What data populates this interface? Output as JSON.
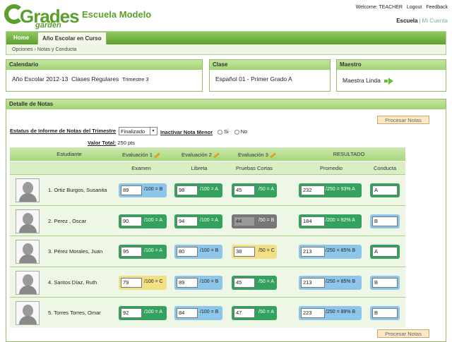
{
  "header": {
    "logo_main": "Grades",
    "logo_sub": "garden",
    "school": "Escuela Modelo",
    "welcome": "Welcome: TEACHER",
    "logout": "Logout",
    "feedback": "Feedback",
    "lang_active": "Escuela",
    "lang_other": "Mi Cuenta"
  },
  "nav": {
    "tabs": [
      "Home",
      "Año Escolar en Curso"
    ],
    "breadcrumb": [
      "Opciones",
      "Notas y Conducta"
    ]
  },
  "calendario": {
    "title": "Calendario",
    "year": "Año Escolar 2012-13",
    "type": "Clases Regulares",
    "term": "Trimestre 3"
  },
  "clase": {
    "title": "Clase",
    "name": "Español 01 -  Primer Grado  A"
  },
  "maestro": {
    "title": "Maestro",
    "name": "Maestra Linda"
  },
  "detalle": {
    "title": "Detalle de Notas",
    "process_label": "Procesar Notas",
    "status_label": "Estatus de Informe de Notas del Trimestre",
    "status_value": "Finalizado",
    "inactivar_label": "Inactivar Nota Menor",
    "radio_si": "Si",
    "radio_no": "No",
    "valor_label": "Valor Total:",
    "valor_value": "250 pts"
  },
  "table": {
    "h_student": "Estudiante",
    "h_eval1": "Evaluación 1",
    "h_eval2": "Evaluación 2",
    "h_eval3": "Evaluación 3",
    "h_result": "RESULTADO",
    "h_examen": "Examen",
    "h_libreta": "Libreta",
    "h_pruebas": "Pruebas Cortas",
    "h_promedio": "Promedio",
    "h_conducta": "Conducta",
    "rows": [
      {
        "name": "1. Ortiz Burgos, Susanita",
        "examen": "89",
        "examen_l": "/100 = B",
        "examen_c": "c-b",
        "libreta": "98",
        "libreta_l": "/100 = A",
        "libreta_c": "c-g",
        "pruebas": "45",
        "pruebas_l": "/50 = A",
        "pruebas_c": "c-g",
        "prom": "232",
        "prom_l": "/250 = 93% A",
        "prom_c": "c-g",
        "conducta": "A",
        "conducta_c": "c-g"
      },
      {
        "name": "2. Perez , Oscar",
        "examen": "90",
        "examen_l": "/100 = A",
        "examen_c": "c-g",
        "libreta": "94",
        "libreta_l": "/100 = A",
        "libreta_c": "c-g",
        "pruebas": "44",
        "pruebas_l": "/50 = B",
        "pruebas_c": "c-gr",
        "prom": "184",
        "prom_l": "/200 = 92% A",
        "prom_c": "c-g",
        "conducta": "B",
        "conducta_c": "c-b"
      },
      {
        "name": "3. Pérez Morales, Juan",
        "examen": "95",
        "examen_l": "/100 = A",
        "examen_c": "c-g",
        "libreta": "80",
        "libreta_l": "/100 = B",
        "libreta_c": "c-b",
        "pruebas": "38",
        "pruebas_l": "/50 = C",
        "pruebas_c": "c-y",
        "prom": "213",
        "prom_l": "/250 = 85% B",
        "prom_c": "c-b",
        "conducta": "A",
        "conducta_c": "c-g"
      },
      {
        "name": "4. Santos Díaz, Ruth",
        "examen": "79",
        "examen_l": "/100 = C",
        "examen_c": "c-y",
        "libreta": "89",
        "libreta_l": "/100 = B",
        "libreta_c": "c-b",
        "pruebas": "45",
        "pruebas_l": "/50 = A",
        "pruebas_c": "c-g",
        "prom": "213",
        "prom_l": "/250 = 85% B",
        "prom_c": "c-b",
        "conducta": "B",
        "conducta_c": "c-b"
      },
      {
        "name": "5. Torres Torres, Omar",
        "examen": "92",
        "examen_l": "/100 = A",
        "examen_c": "c-g",
        "libreta": "84",
        "libreta_l": "/100 = B",
        "libreta_c": "c-b",
        "pruebas": "47",
        "pruebas_l": "/50 = A",
        "pruebas_c": "c-g",
        "prom": "223",
        "prom_l": "/250 = 89% B",
        "prom_c": "c-b",
        "conducta": "B",
        "conducta_c": "c-b"
      }
    ]
  },
  "colors": {
    "green": "#35a15f",
    "blue": "#8ec6ea",
    "yellow": "#f3df86",
    "gray": "#777777",
    "brand": "#5a9e2c"
  }
}
